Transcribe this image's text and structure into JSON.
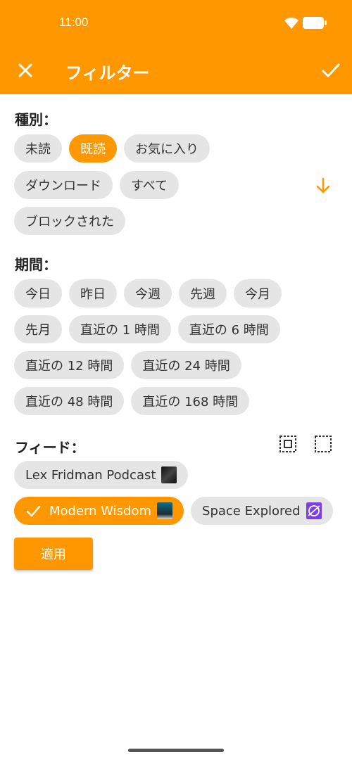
{
  "status_bar": {
    "time": "11:00"
  },
  "toolbar": {
    "title": "フィルター"
  },
  "type_section": {
    "title": "種別：",
    "rows": [
      [
        {
          "label": "未読",
          "selected": false
        },
        {
          "label": "既読",
          "selected": true
        },
        {
          "label": "お気に入り",
          "selected": false
        }
      ],
      [
        {
          "label": "ダウンロード",
          "selected": false
        },
        {
          "label": "すべて",
          "selected": false
        }
      ],
      [
        {
          "label": "ブロックされた",
          "selected": false
        }
      ]
    ]
  },
  "period_section": {
    "title": "期間：",
    "rows": [
      [
        "今日",
        "昨日",
        "今週",
        "先週",
        "今月"
      ],
      [
        "先月",
        "直近の 1 時間",
        "直近の 6 時間"
      ],
      [
        "直近の 12 時間",
        "直近の 24 時間"
      ],
      [
        "直近の 48 時間",
        "直近の 168 時間"
      ]
    ]
  },
  "feed_section": {
    "title": "フィード：",
    "feeds": [
      {
        "label": "Lex Fridman Podcast",
        "selected": false
      },
      {
        "label": "Modern Wisdom",
        "selected": true
      },
      {
        "label": "Space Explored",
        "selected": false
      }
    ]
  },
  "apply_button": {
    "label": "適用"
  },
  "colors": {
    "accent": "#FF9800",
    "chip_bg": "#E5E5E5",
    "space_icon": "#7B3FE4"
  }
}
